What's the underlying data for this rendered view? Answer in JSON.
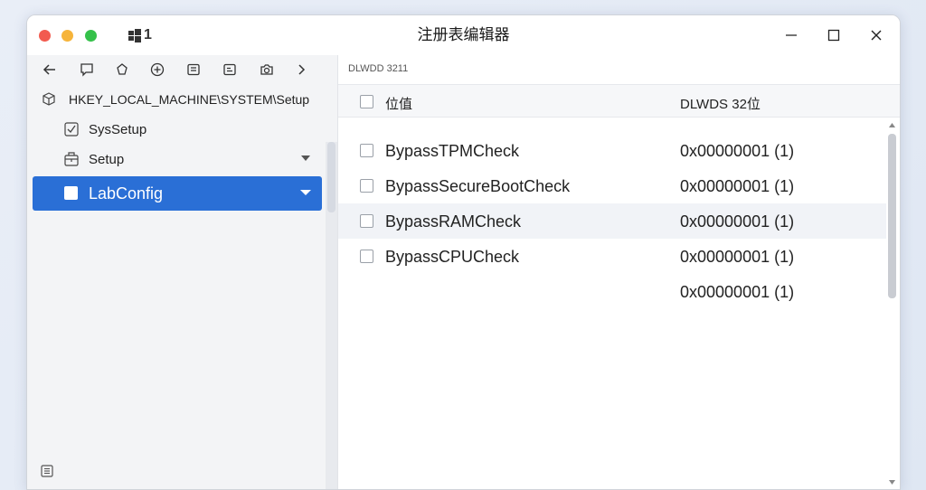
{
  "window": {
    "title": "注册表编辑器",
    "app_badge": "1",
    "accent": "#2a6fd6"
  },
  "toolbar": {
    "buttons": [
      "back-arrow-icon",
      "comment-icon",
      "shield-icon",
      "add-circle-icon",
      "list-icon",
      "calendar-icon",
      "camera-icon",
      "forward-arrow-icon"
    ]
  },
  "tree": {
    "root": "HKEY_LOCAL_MACHINE\\SYSTEM\\Setup",
    "items": [
      {
        "label": "SysSetup"
      },
      {
        "label": "Setup"
      },
      {
        "label": "LabConfig"
      }
    ]
  },
  "right": {
    "path": "DLWDD 3211",
    "columns": {
      "name": "位值",
      "value": "DLWDS 32位"
    },
    "rows": [
      {
        "name": "BypassTPMCheck",
        "value": "0x00000001 (1)"
      },
      {
        "name": "BypassSecureBootCheck",
        "value": "0x00000001 (1)"
      },
      {
        "name": "BypassRAMCheck",
        "value": "0x00000001 (1)"
      },
      {
        "name": "BypassCPUCheck",
        "value": "0x00000001 (1)"
      },
      {
        "name": "",
        "value": "0x00000001 (1)"
      }
    ]
  }
}
